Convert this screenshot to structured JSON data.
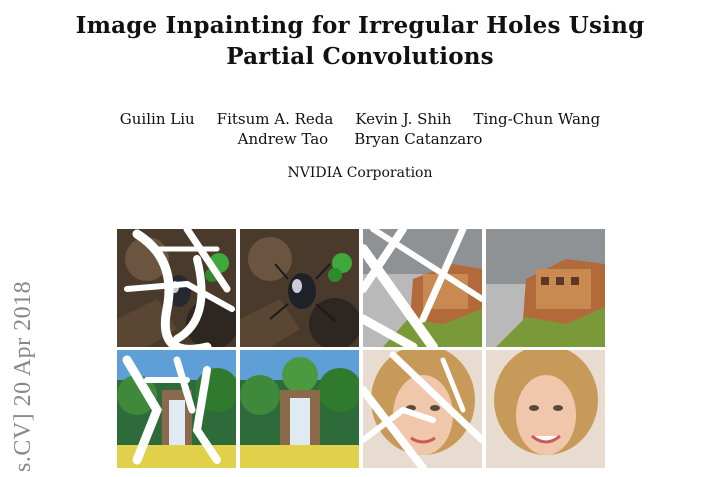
{
  "paper": {
    "title_line1": "Image Inpainting for Irregular Holes Using",
    "title_line2": "Partial Convolutions",
    "authors_row1": [
      "Guilin Liu",
      "Fitsum A. Reda",
      "Kevin J. Shih",
      "Ting-Chun Wang"
    ],
    "authors_row2": [
      "Andrew Tao",
      "Bryan Catanzaro"
    ],
    "affiliation": "NVIDIA Corporation",
    "arxiv_stamp": "s.CV]  20 Apr 2018"
  },
  "figure": {
    "panels": [
      {
        "name": "beetle-masked",
        "masked": true
      },
      {
        "name": "beetle-result",
        "masked": false
      },
      {
        "name": "cliff-masked",
        "masked": true
      },
      {
        "name": "cliff-result",
        "masked": false
      },
      {
        "name": "waterfall-masked",
        "masked": true
      },
      {
        "name": "waterfall-result",
        "masked": false
      },
      {
        "name": "face-masked",
        "masked": true
      },
      {
        "name": "face-result",
        "masked": false
      }
    ]
  }
}
